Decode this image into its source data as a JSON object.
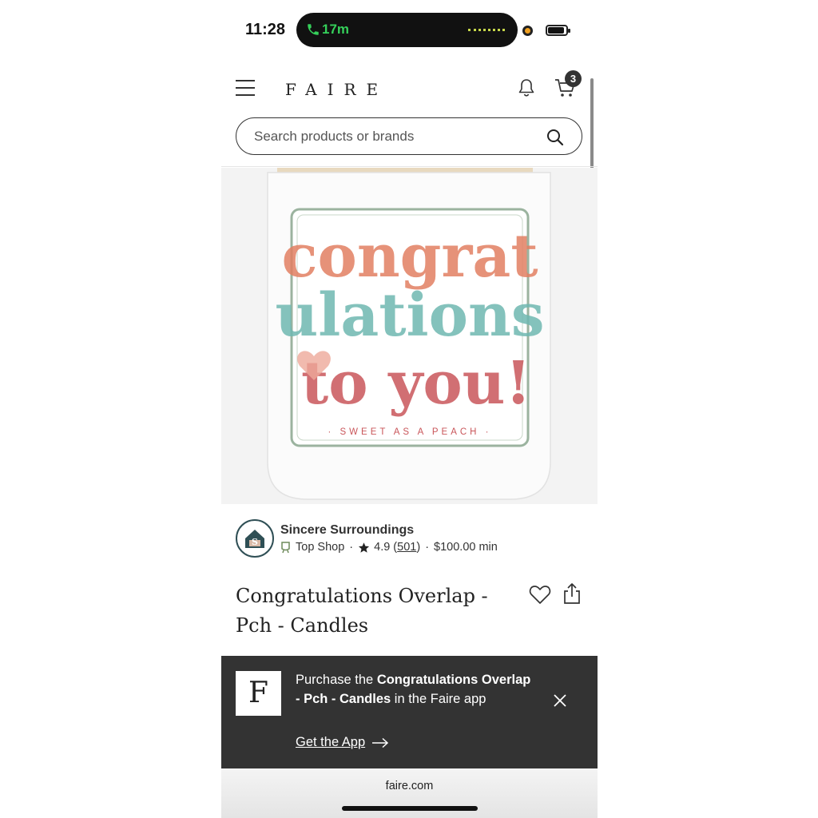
{
  "status_bar": {
    "time": "11:28",
    "call_duration": "17m",
    "call_color": "#35d05a"
  },
  "header": {
    "logo": "FAIRE",
    "cart_count": "3",
    "icons": [
      "menu-icon",
      "bell-icon",
      "cart-icon"
    ]
  },
  "search": {
    "placeholder": "Search products or brands",
    "value": ""
  },
  "product_image": {
    "label_lines": [
      "congrat",
      "ulations",
      "to you!"
    ],
    "tagline": "· SWEET AS A PEACH ·"
  },
  "shop": {
    "name": "Sincere Surroundings",
    "badge": "Top Shop",
    "rating": "4.9",
    "review_count": "501",
    "minimum": "$100.00 min"
  },
  "product": {
    "title": "Congratulations Overlap - Pch - Candles"
  },
  "app_banner": {
    "logo_letter": "F",
    "text_prefix": "Purchase the ",
    "text_bold": "Congratulations Overlap - Pch - Candles",
    "text_suffix": " in the Faire app",
    "cta": "Get the App",
    "background": "#333333"
  },
  "browser": {
    "url": "faire.com"
  }
}
